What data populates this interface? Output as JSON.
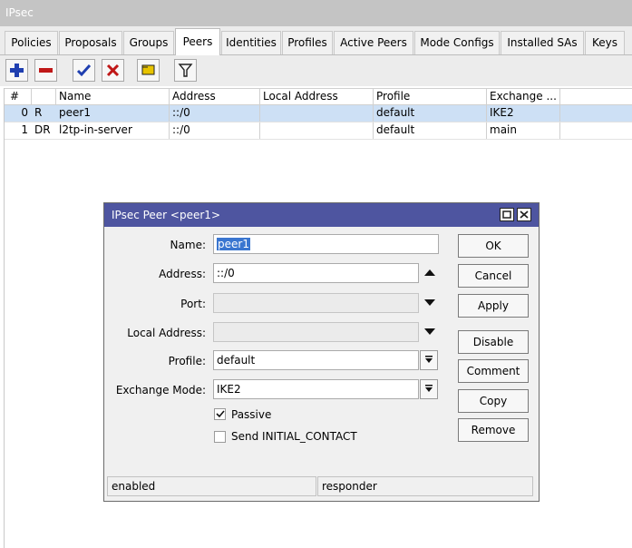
{
  "window": {
    "title": "IPsec"
  },
  "tabs": [
    {
      "label": "Policies"
    },
    {
      "label": "Proposals"
    },
    {
      "label": "Groups"
    },
    {
      "label": "Peers"
    },
    {
      "label": "Identities"
    },
    {
      "label": "Profiles"
    },
    {
      "label": "Active Peers"
    },
    {
      "label": "Mode Configs"
    },
    {
      "label": "Installed SAs"
    },
    {
      "label": "Keys"
    }
  ],
  "active_tab": "Peers",
  "toolbar": {
    "icons": [
      "add-icon",
      "remove-icon",
      "enable-icon",
      "disable-icon",
      "comment-icon",
      "filter-icon"
    ],
    "colors": {
      "add": "#1f3fb0",
      "remove": "#c01818",
      "enable": "#1f3fb0",
      "disable": "#c01818",
      "comment": "#e8c400"
    }
  },
  "table": {
    "columns": [
      "#",
      "",
      "Name",
      "Address",
      "Local Address",
      "Profile",
      "Exchange ..."
    ],
    "rows": [
      {
        "num": "0",
        "flags": "R",
        "name": "peer1",
        "address": "::/0",
        "local_address": "",
        "profile": "default",
        "exchange": "IKE2"
      },
      {
        "num": "1",
        "flags": "DR",
        "name": "l2tp-in-server",
        "address": "::/0",
        "local_address": "",
        "profile": "default",
        "exchange": "main"
      }
    ]
  },
  "dialog": {
    "title": "IPsec Peer <peer1>",
    "labels": {
      "name": "Name:",
      "address": "Address:",
      "port": "Port:",
      "local_address": "Local Address:",
      "profile": "Profile:",
      "exchange_mode": "Exchange Mode:"
    },
    "values": {
      "name": "peer1",
      "address": "::/0",
      "port": "",
      "local_address": "",
      "profile": "default",
      "exchange_mode": "IKE2"
    },
    "checkboxes": {
      "passive": {
        "label": "Passive",
        "checked": true
      },
      "send_initial_contact": {
        "label": "Send INITIAL_CONTACT",
        "checked": false
      }
    },
    "buttons": {
      "ok": "OK",
      "cancel": "Cancel",
      "apply": "Apply",
      "disable": "Disable",
      "comment": "Comment",
      "copy": "Copy",
      "remove": "Remove"
    },
    "status": {
      "left": "enabled",
      "right": "responder"
    }
  }
}
